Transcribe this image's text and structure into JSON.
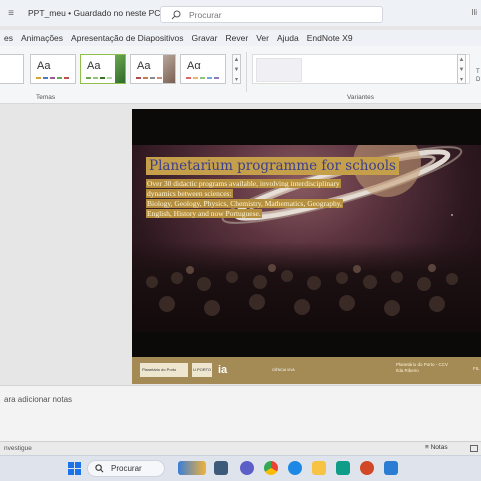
{
  "titlebar": {
    "doc_name": "PPT_meu • Guardado no neste PC",
    "chevron": "∨",
    "search_placeholder": "Procurar",
    "user": "Ili"
  },
  "tabs": [
    "es",
    "Animações",
    "Apresentação de Diapositivos",
    "Gravar",
    "Rever",
    "Ver",
    "Ajuda",
    "EndNote X9"
  ],
  "ribbon": {
    "themes_label": "Temas",
    "variants_label": "Variantes",
    "theme_sample": "Aa",
    "theme_sample_alt": "Aα",
    "right_stub": [
      "T",
      "D"
    ]
  },
  "slide": {
    "title": "Planetarium programme for schools",
    "body_lines": [
      "Over 30 didactic programs available, involving interdisciplinary",
      "dynamics between sciences:",
      "Biology, Geology, Physics, Chemistry, Mathematics, Geography,",
      "English, History and now Portuguese."
    ],
    "footer_logos": [
      "Planetário do Porto",
      "U.PORTO",
      "ia",
      "CIÊNCIA VIVA"
    ],
    "credit_line1": "Planetário do Porto - CCV",
    "credit_line2": "Ilda Ribeiro",
    "slide_number": "FIL"
  },
  "notes": {
    "placeholder": "ara adicionar notas"
  },
  "statusbar": {
    "left": "nvestigue",
    "notes_button": "≡ Notas"
  },
  "taskbar": {
    "search_label": "Procurar"
  },
  "colors": {
    "title_bg": "#c69f4a",
    "title_fg": "#3b3f8f",
    "footer": "#a48a55",
    "windows_blue": "#1a73e8"
  }
}
